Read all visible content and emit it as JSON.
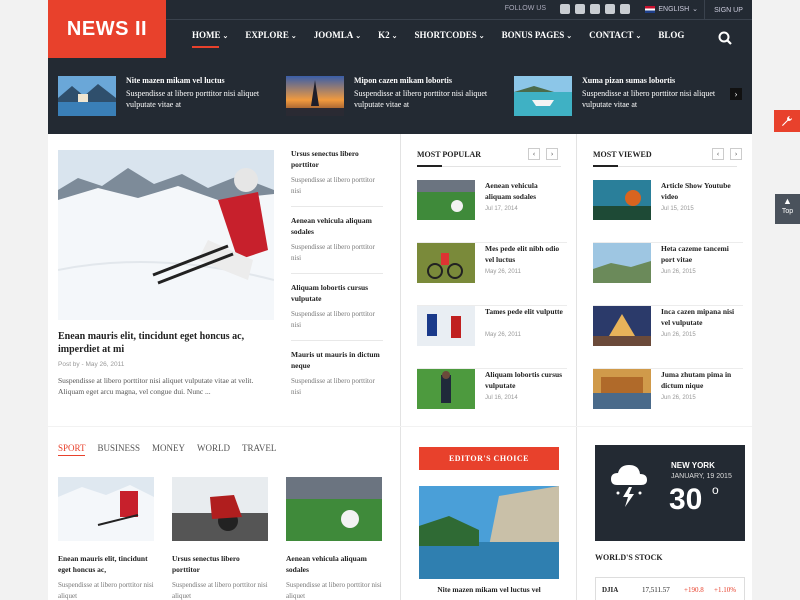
{
  "logo": "NEWS II",
  "topbar": {
    "follow": "FOLLOW US",
    "language": "ENGLISH",
    "signup": "SIGN UP"
  },
  "nav": [
    "HOME",
    "EXPLORE",
    "JOOMLA",
    "K2",
    "SHORTCODES",
    "BONUS PAGES",
    "CONTACT",
    "BLOG"
  ],
  "slider": [
    {
      "title": "Nite mazen mikam vel luctus",
      "desc": "Suspendisse at libero porttitor nisi aliquet vulputate vitae at"
    },
    {
      "title": "Mipon cazen mikam lobortis",
      "desc": "Suspendisse at libero porttitor nisi aliquet vulputate vitae at"
    },
    {
      "title": "Xuma pizan sumas lobortis",
      "desc": "Suspendisse at libero porttitor nisi aliquet vulputate vitae at"
    }
  ],
  "featured": {
    "title": "Enean mauris elit, tincidunt eget honcus ac, imperdiet at mi",
    "meta": "Post by - May 26, 2011",
    "desc": "Suspendisse at libero porttitor nisi aliquet vulputate vitae at velit. Aliquam eget arcu magna, vel congue dui. Nunc ..."
  },
  "side_list": [
    {
      "title": "Ursus senectus libero porttitor",
      "desc": "Suspendisse at libero porttitor nisi"
    },
    {
      "title": "Aenean vehicula aliquam sodales",
      "desc": "Suspendisse at libero porttitor nisi"
    },
    {
      "title": "Aliquam lobortis cursus vulputate",
      "desc": "Suspendisse at libero porttitor nisi"
    },
    {
      "title": "Mauris ut mauris in dictum neque",
      "desc": "Suspendisse at libero porttitor nisi"
    }
  ],
  "popular": {
    "title": "MOST POPULAR",
    "items": [
      {
        "title": "Aenean vehicula aliquam sodales",
        "date": "Jul 17, 2014"
      },
      {
        "title": "Mes pede elit nibh odio vel luctus",
        "date": "May 26, 2011"
      },
      {
        "title": "Tames pede elit vulputte",
        "date": "May 26, 2011"
      },
      {
        "title": "Aliquam lobortis cursus vulputate",
        "date": "Jul 16, 2014"
      }
    ]
  },
  "viewed": {
    "title": "MOST VIEWED",
    "items": [
      {
        "title": "Article Show Youtube video",
        "date": "Jul 15, 2015"
      },
      {
        "title": "Heta cazeme tancemi port vitae",
        "date": "Jun 26, 2015"
      },
      {
        "title": "Inca cazen mipana nisi vel vulputate",
        "date": "Jun 26, 2015"
      },
      {
        "title": "Juma zhutam pima in dictum nique",
        "date": "Jun 26, 2015"
      }
    ]
  },
  "tabs": [
    "SPORT",
    "BUSINESS",
    "MONEY",
    "WORLD",
    "TRAVEL"
  ],
  "category_cards": [
    {
      "title": "Enean mauris elit, tincidunt eget honcus ac,",
      "desc": "Suspendisse at libero porttitor nisi aliquet"
    },
    {
      "title": "Ursus senectus libero porttitor",
      "desc": "Suspendisse at libero porttitor nisi aliquet"
    },
    {
      "title": "Aenean vehicula aliquam sodales",
      "desc": "Suspendisse at libero porttitor nisi aliquet"
    }
  ],
  "editors_choice": {
    "label": "EDITOR'S CHOICE",
    "title": "Nite mazen mikam vel luctus vel"
  },
  "weather": {
    "city": "NEW YORK",
    "date": "JANUARY, 19 2015",
    "temp": "30",
    "deg": "o"
  },
  "stock": {
    "title": "WORLD'S STOCK",
    "row": {
      "name": "DJIA",
      "value": "17,511.57",
      "change": "+190.8",
      "pct": "+1.10%"
    }
  },
  "floating": {
    "top": "Top"
  },
  "colors": {
    "accent": "#e8412c",
    "dark": "#232a33"
  }
}
